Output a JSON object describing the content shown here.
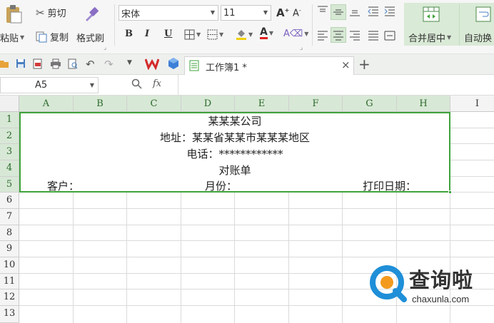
{
  "ribbon": {
    "paste_label": "粘贴",
    "cut_label": "剪切",
    "copy_label": "复制",
    "format_painter_label": "格式刷",
    "font_name": "宋体",
    "font_size": "11",
    "bold": "B",
    "italic": "I",
    "underline": "U",
    "merge_center_label": "合并居中",
    "wrap_label": "自动换",
    "accent_color": "#3fa33a"
  },
  "tabbar": {
    "doc_tab_title": "工作簿1 *",
    "close_glyph": "×",
    "new_tab_glyph": "+"
  },
  "formula_bar": {
    "name_box": "A5",
    "fx": "fx"
  },
  "sheet": {
    "columns": [
      "A",
      "B",
      "C",
      "D",
      "E",
      "F",
      "G",
      "H",
      "I"
    ],
    "rows": [
      "1",
      "2",
      "3",
      "4",
      "5",
      "6",
      "7",
      "8",
      "9",
      "10",
      "11",
      "12",
      "13"
    ],
    "cells": {
      "r1": "某某某公司",
      "r2": "地址：某某省某某市某某某地区",
      "r3": "电话：************",
      "r4": "对账单",
      "r5_customer": "客户：",
      "r5_month": "月份：",
      "r5_print_date": "打印日期："
    }
  },
  "watermark": {
    "brand": "查询啦",
    "url": "chaxunla.com",
    "brand_color": "#1f8fd8",
    "accent_orange": "#f39a1e"
  }
}
